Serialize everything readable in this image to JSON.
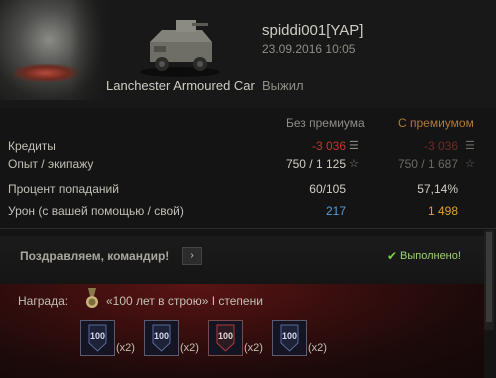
{
  "header": {
    "player": "spiddi001[YAP]",
    "datetime": "23.09.2016 10:05",
    "vehicle_name": "Lanchester Armoured Car",
    "battle_status": "Выжил"
  },
  "columns": {
    "no_premium": "Без премиума",
    "premium": "С премиумом"
  },
  "stats": [
    {
      "label": "Кредиты",
      "no_premium": "-3 036",
      "premium": "-3 036",
      "icon": "credits-icon"
    },
    {
      "label": "Опыт / экипажу",
      "no_premium": "750 / 1 125",
      "premium": "750 / 1 687",
      "icon": "star-icon"
    },
    {
      "label": "Процент попаданий",
      "no_premium": "60/105",
      "premium": "57,14%"
    },
    {
      "label": "Урон (с вашей помощью / свой)",
      "no_premium": "217",
      "premium": "1 498"
    }
  ],
  "mission": {
    "title": "Поздравляем, командир!",
    "arrow": "›",
    "status": "Выполнено!"
  },
  "reward": {
    "label": "Награда:",
    "name": "«100 лет в строю» I степени",
    "badges": [
      {
        "text": "100",
        "multiplier": "(x2)",
        "accent": "#5a6aa0"
      },
      {
        "text": "100",
        "multiplier": "(x2)",
        "accent": "#5a6aa0"
      },
      {
        "text": "100",
        "multiplier": "(x2)",
        "accent": "#b03a3a"
      },
      {
        "text": "100",
        "multiplier": "(x2)",
        "accent": "#5a6aa0"
      }
    ]
  },
  "colors": {
    "negative": "#c0392b",
    "negative_dim": "#6e2b26",
    "damage_blue": "#5b9bd5",
    "damage_orange": "#e0a030",
    "premium_header": "#b07a38",
    "success_green": "#7bd14b"
  }
}
